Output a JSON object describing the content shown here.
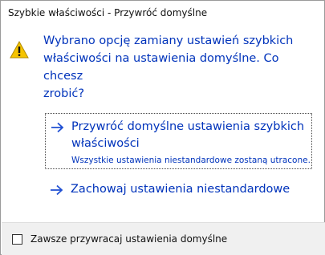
{
  "window": {
    "title": "Szybkie właściwości - Przywróć domyślne"
  },
  "message": {
    "icon": "warning-triangle-icon",
    "text": "Wybrano opcję zamiany ustawień szybkich\nwłaściwości na ustawienia domyślne. Co chcesz\nzrobić?"
  },
  "commands": [
    {
      "icon": "arrow-right-icon",
      "label": "Przywróć domyślne ustawienia szybkich\nwłaściwości",
      "note": "Wszystkie ustawienia niestandardowe zostaną utracone."
    },
    {
      "icon": "arrow-right-icon",
      "label": "Zachowaj ustawienia niestandardowe"
    }
  ],
  "footer": {
    "checkbox_label": "Zawsze przywracaj ustawienia domyślne",
    "checked": false
  },
  "colors": {
    "instruction_text": "#0033bb",
    "warning_fill": "#f5c400",
    "footer_bg": "#f0f0f0"
  }
}
